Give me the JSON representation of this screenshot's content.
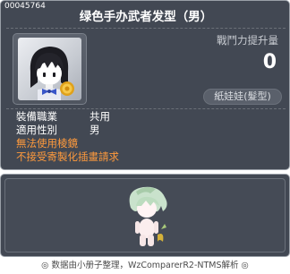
{
  "tooltip": {
    "item_id": "00045764",
    "item_name": "绿色手办武者发型（男）",
    "stat_label": "戰鬥力提升量",
    "stat_value": "0",
    "category": "紙娃娃(髮型)",
    "rows": [
      {
        "label": "裝備職業",
        "value": "共用"
      },
      {
        "label": "適用性別",
        "value": "男"
      }
    ],
    "warnings": [
      "無法使用棱鏡",
      "不接受寄製化插畫請求"
    ],
    "colors": {
      "panel": "#424853",
      "warning": "#ff9a3c",
      "text": "#ffffff"
    }
  },
  "preview": {
    "character": "hair-preview-character"
  },
  "footer": {
    "text": "◎ 数据由小册子整理，WzComparerR2-NTMS解析 ◎"
  }
}
